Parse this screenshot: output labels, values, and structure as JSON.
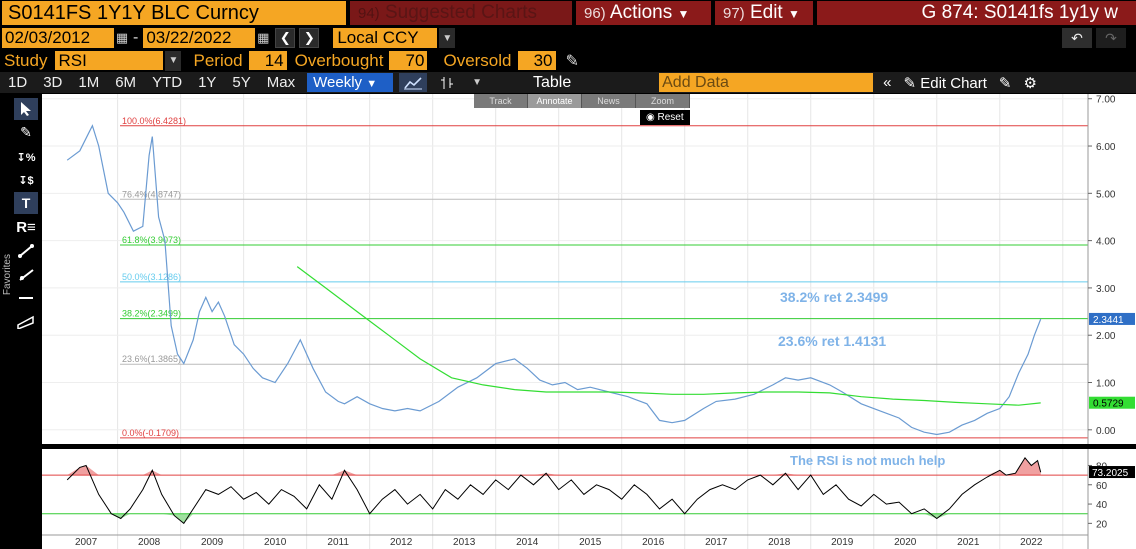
{
  "header": {
    "ticker": "S0141FS 1Y1Y BLC Curncy",
    "suggested_num": "94)",
    "suggested_label": "Suggested Charts",
    "actions_num": "96)",
    "actions_label": "Actions",
    "edit_num": "97)",
    "edit_label": "Edit",
    "screen_title": "G 874: S0141fs 1y1y w"
  },
  "controls": {
    "start_date": "02/03/2012",
    "end_date": "03/22/2022",
    "currency": "Local CCY",
    "study_label": "Study",
    "study_value": "RSI",
    "period_label": "Period",
    "period_value": "14",
    "overbought_label": "Overbought",
    "overbought_value": "70",
    "oversold_label": "Oversold",
    "oversold_value": "30"
  },
  "toolbar": {
    "ranges": [
      "1D",
      "3D",
      "1M",
      "6M",
      "YTD",
      "1Y",
      "5Y",
      "Max"
    ],
    "frequency": "Weekly",
    "table_label": "Table",
    "add_data_placeholder": "Add Data",
    "edit_chart_label": "Edit Chart"
  },
  "chart_toolbar": {
    "track": "Track",
    "annotate": "Annotate",
    "news": "News",
    "zoom": "Zoom",
    "reset": "Reset"
  },
  "icons": {
    "left_toolbar": [
      "pointer-icon",
      "pen-icon",
      "percent-line-icon",
      "dollar-line-icon",
      "text-icon",
      "regression-icon",
      "trend-line-icon",
      "ray-icon",
      "horizontal-line-icon",
      "channel-icon"
    ]
  },
  "colors": {
    "orange": "#f5a623",
    "red_bar": "#8b1a1a",
    "price_line": "#6b9bd2",
    "ma_line": "#33dd33",
    "fib_red": "#e04040",
    "fib_green": "#33cc33",
    "fib_cyan": "#66ccee",
    "rsi_line": "#000000"
  },
  "fib_levels": [
    {
      "label": "100.0%(6.4281)",
      "value": 6.4281,
      "color": "#e04040"
    },
    {
      "label": "76.4%(4.8747)",
      "value": 4.8747,
      "color": "#bbbbbb"
    },
    {
      "label": "61.8%(3.9073)",
      "value": 3.9073,
      "color": "#33cc33"
    },
    {
      "label": "50.0%(3.1286)",
      "value": 3.1286,
      "color": "#66ccee"
    },
    {
      "label": "38.2%(2.3499)",
      "value": 2.3499,
      "color": "#33cc33"
    },
    {
      "label": "23.6%(1.3865)",
      "value": 1.3865,
      "color": "#bbbbbb"
    },
    {
      "label": "0.0%(-0.1709)",
      "value": -0.1709,
      "color": "#e04040"
    }
  ],
  "annotations": {
    "ret_382": "38.2% ret  2.3499",
    "ret_236": "23.6% ret 1.4131",
    "rsi_note": "The RSI is not much help"
  },
  "chart_data": [
    {
      "type": "line",
      "y_axis_ticks": [
        "7.00",
        "6.00",
        "5.00",
        "4.00",
        "3.00",
        "2.00",
        "1.00",
        "0.00"
      ],
      "ylim": [
        -0.3,
        7.1
      ],
      "x_axis_ticks": [
        "2007",
        "2008",
        "2009",
        "2010",
        "2011",
        "2012",
        "2013",
        "2014",
        "2015",
        "2016",
        "2017",
        "2018",
        "2019",
        "2020",
        "2021",
        "2022"
      ],
      "last_price_label": "2.3441",
      "ma_label": "0.5729",
      "series": [
        {
          "role": "price",
          "x": [
            2006.7,
            2006.9,
            2007.05,
            2007.1,
            2007.2,
            2007.35,
            2007.5,
            2007.6,
            2007.75,
            2007.9,
            2008.0,
            2008.05,
            2008.15,
            2008.25,
            2008.35,
            2008.45,
            2008.55,
            2008.7,
            2008.8,
            2008.9,
            2009.0,
            2009.1,
            2009.2,
            2009.35,
            2009.5,
            2009.65,
            2009.8,
            2010.0,
            2010.2,
            2010.4,
            2010.6,
            2010.8,
            2011.0,
            2011.1,
            2011.3,
            2011.5,
            2011.7,
            2011.9,
            2012.1,
            2012.3,
            2012.6,
            2012.9,
            2013.2,
            2013.5,
            2013.8,
            2014.0,
            2014.2,
            2014.4,
            2014.6,
            2014.8,
            2015.0,
            2015.3,
            2015.6,
            2015.9,
            2016.1,
            2016.3,
            2016.5,
            2016.8,
            2017.0,
            2017.3,
            2017.6,
            2017.9,
            2018.1,
            2018.3,
            2018.5,
            2018.8,
            2019.0,
            2019.3,
            2019.6,
            2019.9,
            2020.1,
            2020.3,
            2020.5,
            2020.7,
            2020.9,
            2021.1,
            2021.3,
            2021.5,
            2021.65,
            2021.8,
            2021.95,
            2022.05,
            2022.15
          ],
          "y": [
            5.7,
            5.9,
            6.3,
            6.43,
            6.0,
            5.0,
            4.8,
            4.6,
            4.2,
            4.3,
            5.8,
            6.2,
            4.5,
            4.0,
            2.2,
            1.6,
            1.4,
            1.9,
            2.5,
            2.8,
            2.5,
            2.7,
            2.4,
            1.8,
            1.6,
            1.3,
            1.1,
            1.0,
            1.4,
            1.9,
            1.3,
            0.8,
            0.6,
            0.55,
            0.7,
            0.55,
            0.45,
            0.4,
            0.45,
            0.4,
            0.6,
            0.9,
            1.1,
            1.4,
            1.5,
            1.3,
            1.05,
            0.95,
            1.0,
            0.85,
            0.9,
            0.8,
            0.7,
            0.55,
            0.2,
            0.15,
            0.2,
            0.45,
            0.6,
            0.65,
            0.75,
            0.95,
            1.1,
            1.05,
            1.1,
            0.95,
            0.8,
            0.55,
            0.4,
            0.25,
            0.05,
            -0.05,
            -0.1,
            -0.05,
            0.1,
            0.2,
            0.35,
            0.45,
            0.7,
            1.2,
            1.6,
            2.0,
            2.34
          ]
        },
        {
          "role": "moving_average",
          "x": [
            2010.35,
            2010.8,
            2011.3,
            2011.8,
            2012.3,
            2012.8,
            2013.3,
            2013.8,
            2014.3,
            2014.8,
            2015.3,
            2015.8,
            2016.3,
            2016.8,
            2017.3,
            2017.8,
            2018.3,
            2018.8,
            2019.3,
            2019.8,
            2020.3,
            2020.8,
            2021.3,
            2021.8,
            2022.15
          ],
          "y": [
            3.45,
            3.0,
            2.5,
            2.0,
            1.5,
            1.1,
            0.95,
            0.85,
            0.8,
            0.8,
            0.8,
            0.78,
            0.75,
            0.75,
            0.78,
            0.8,
            0.8,
            0.78,
            0.7,
            0.65,
            0.62,
            0.58,
            0.55,
            0.52,
            0.57
          ]
        }
      ]
    },
    {
      "type": "line",
      "y_axis_ticks": [
        "80",
        "60",
        "40",
        "20"
      ],
      "ylim": [
        10,
        95
      ],
      "overbought": 70,
      "oversold": 30,
      "last_value_label": "73.2025",
      "series": [
        {
          "role": "rsi",
          "x": [
            2006.7,
            2006.9,
            2007.0,
            2007.2,
            2007.4,
            2007.55,
            2007.7,
            2007.9,
            2008.05,
            2008.2,
            2008.4,
            2008.55,
            2008.7,
            2008.9,
            2009.1,
            2009.3,
            2009.5,
            2009.7,
            2009.9,
            2010.1,
            2010.3,
            2010.5,
            2010.7,
            2010.9,
            2011.1,
            2011.3,
            2011.5,
            2011.7,
            2011.9,
            2012.1,
            2012.3,
            2012.5,
            2012.7,
            2012.9,
            2013.1,
            2013.3,
            2013.5,
            2013.7,
            2013.9,
            2014.1,
            2014.3,
            2014.5,
            2014.7,
            2014.9,
            2015.1,
            2015.3,
            2015.5,
            2015.7,
            2015.9,
            2016.1,
            2016.3,
            2016.5,
            2016.7,
            2016.9,
            2017.1,
            2017.3,
            2017.5,
            2017.7,
            2017.9,
            2018.1,
            2018.3,
            2018.5,
            2018.7,
            2018.9,
            2019.1,
            2019.3,
            2019.5,
            2019.7,
            2019.9,
            2020.1,
            2020.3,
            2020.5,
            2020.7,
            2020.9,
            2021.1,
            2021.3,
            2021.5,
            2021.6,
            2021.75,
            2021.9,
            2022.0,
            2022.1,
            2022.15
          ],
          "y": [
            65,
            78,
            80,
            50,
            30,
            25,
            35,
            55,
            75,
            50,
            28,
            20,
            35,
            55,
            50,
            58,
            45,
            52,
            40,
            55,
            48,
            35,
            60,
            45,
            75,
            55,
            30,
            45,
            55,
            40,
            50,
            35,
            55,
            45,
            60,
            50,
            65,
            55,
            70,
            60,
            72,
            55,
            65,
            50,
            60,
            55,
            45,
            60,
            50,
            35,
            45,
            30,
            45,
            55,
            60,
            55,
            65,
            70,
            60,
            72,
            55,
            70,
            50,
            60,
            45,
            38,
            50,
            40,
            42,
            30,
            35,
            25,
            35,
            50,
            60,
            68,
            75,
            70,
            72,
            88,
            80,
            85,
            73
          ]
        }
      ]
    }
  ]
}
